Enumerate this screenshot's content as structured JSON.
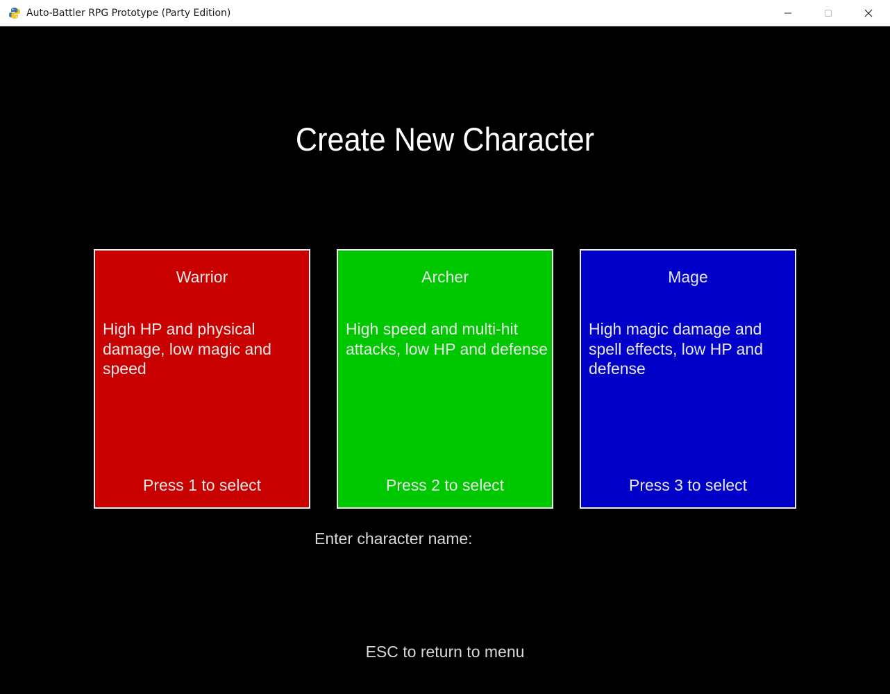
{
  "window": {
    "title": "Auto-Battler RPG Prototype (Party Edition)",
    "icon": "python-snake-icon",
    "controls": [
      "minimize-icon",
      "maximize-icon",
      "close-icon"
    ]
  },
  "screen": {
    "heading": "Create New Character",
    "classes": [
      {
        "name": "Warrior",
        "description": "High HP and physical damage, low magic and speed",
        "select_hint": "Press 1 to select",
        "color": "#c80000"
      },
      {
        "name": "Archer",
        "description": "High speed and multi-hit attacks, low HP and defense",
        "select_hint": "Press 2 to select",
        "color": "#00c800"
      },
      {
        "name": "Mage",
        "description": "High magic damage and spell effects, low HP and defense",
        "select_hint": "Press 3 to select",
        "color": "#0000c8"
      }
    ],
    "name_prompt": "Enter character name:",
    "esc_hint": "ESC to return to menu"
  },
  "colors": {
    "background": "#000000",
    "card_border": "#f0f0f0",
    "text": "#e8e8e8"
  }
}
